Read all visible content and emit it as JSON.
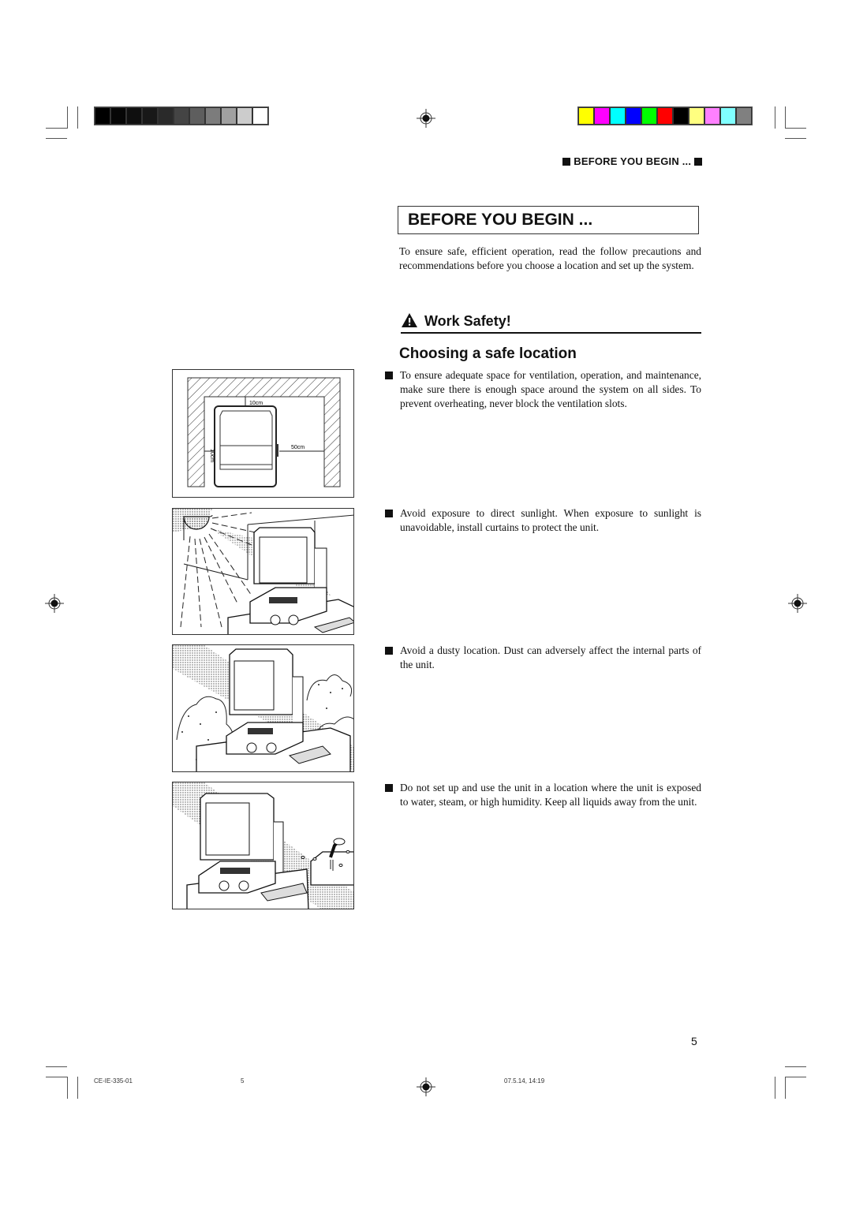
{
  "print_marks": {
    "grayscale_bar": [
      "#000000",
      "#060606",
      "#0f0f0f",
      "#181818",
      "#2a2a2a",
      "#444444",
      "#5e5e5e",
      "#7c7c7c",
      "#a0a0a0",
      "#cccccc",
      "#ffffff"
    ],
    "color_bar": [
      "#ffff00",
      "#ff00ff",
      "#00ffff",
      "#0000ff",
      "#00ff00",
      "#ff0000",
      "#000000",
      "#ffff80",
      "#ff80ff",
      "#80ffff",
      "#808080"
    ]
  },
  "header": {
    "running_title": "BEFORE YOU BEGIN ..."
  },
  "section": {
    "title": "BEFORE YOU BEGIN ...",
    "intro": "To ensure safe, efficient operation, read the follow precautions and recommendations before you choose a location and set up the system.",
    "safety_heading": "Work Safety!",
    "safety_icon": "warning-triangle-icon",
    "subheading": "Choosing a safe location",
    "items": [
      {
        "text": "To ensure adequate space for ventilation, operation, and maintenance, make sure there is enough space around the system on all sides. To prevent overheating, never block the ventilation slots."
      },
      {
        "text": "Avoid exposure to direct sunlight. When exposure to sunlight is unavoidable, install curtains to protect the unit."
      },
      {
        "text": "Avoid a dusty location. Dust can adversely affect the internal parts of the unit."
      },
      {
        "text": "Do not set up and use the unit in a location where the unit is exposed to water, steam, or high humidity. Keep all liquids away from the unit."
      }
    ]
  },
  "figures": {
    "clearance": {
      "top_label": "10cm",
      "side_label": "10cm",
      "right_label": "50cm"
    },
    "sunlight": {
      "alt": "Unit placed near a window with sunlight rays"
    },
    "dust": {
      "alt": "Unit on table surrounded by dust clouds"
    },
    "water": {
      "alt": "Unit near a sink with running water"
    }
  },
  "page_number": "5",
  "footer": {
    "doc_code": "CE-IE-335-01",
    "sheet": "5",
    "timestamp": "07.5.14, 14:19"
  }
}
